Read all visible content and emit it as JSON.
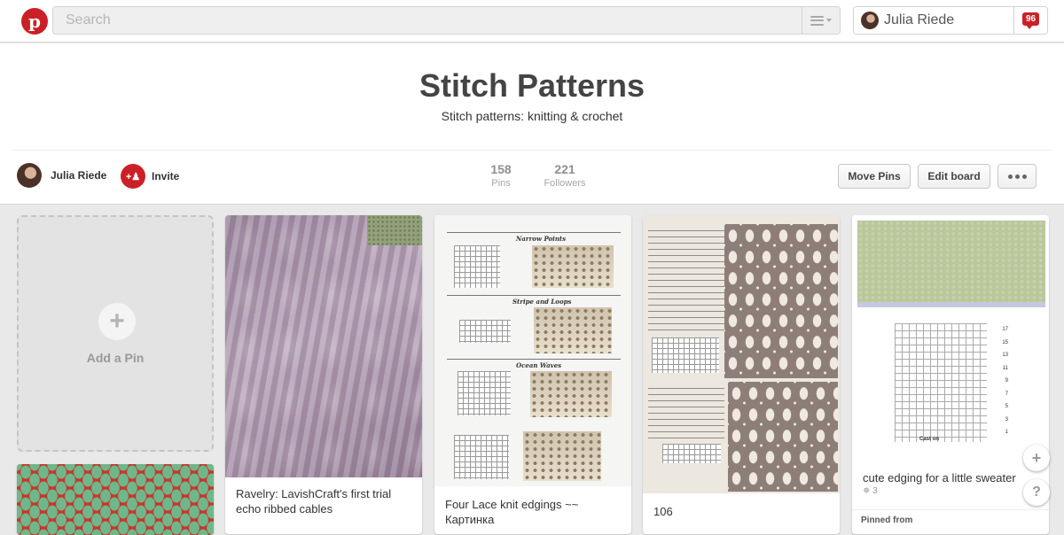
{
  "topbar": {
    "search_placeholder": "Search",
    "user_name": "Julia Riede",
    "notification_count": "96"
  },
  "board": {
    "title": "Stitch Patterns",
    "description": "Stitch patterns: knitting & crochet",
    "owner_name": "Julia Riede",
    "invite_label": "Invite",
    "pins_count": "158",
    "pins_label": "Pins",
    "followers_count": "221",
    "followers_label": "Followers",
    "move_pins_label": "Move Pins",
    "edit_board_label": "Edit board"
  },
  "add_pin": {
    "label": "Add a Pin"
  },
  "pins": [
    {
      "caption": "Ravelry: LavishCraft's first trial echo ribbed cables"
    },
    {
      "caption": "Four Lace knit edgings ~~ Картинка"
    },
    {
      "caption": "106"
    },
    {
      "caption": "cute edging for a little sweater",
      "repins": "3",
      "source_label": "Pinned from"
    }
  ],
  "doc_headings": [
    "Narrow Points",
    "Stripe and Loops",
    "Ocean Waves"
  ],
  "chart_row_numbers": [
    "17",
    "15",
    "13",
    "11",
    "9",
    "7",
    "5",
    "3",
    "1"
  ],
  "chart_caption": "Cast on",
  "icons": {
    "logo": "pinterest-logo-icon",
    "menu": "menu-lines-icon",
    "notification": "notification-speech-icon",
    "invite": "invite-person-icon",
    "more": "more-dots-icon",
    "add": "plus-icon",
    "help": "question-icon"
  },
  "colors": {
    "brand_red": "#cb2027",
    "background": "#e9e9e9"
  }
}
